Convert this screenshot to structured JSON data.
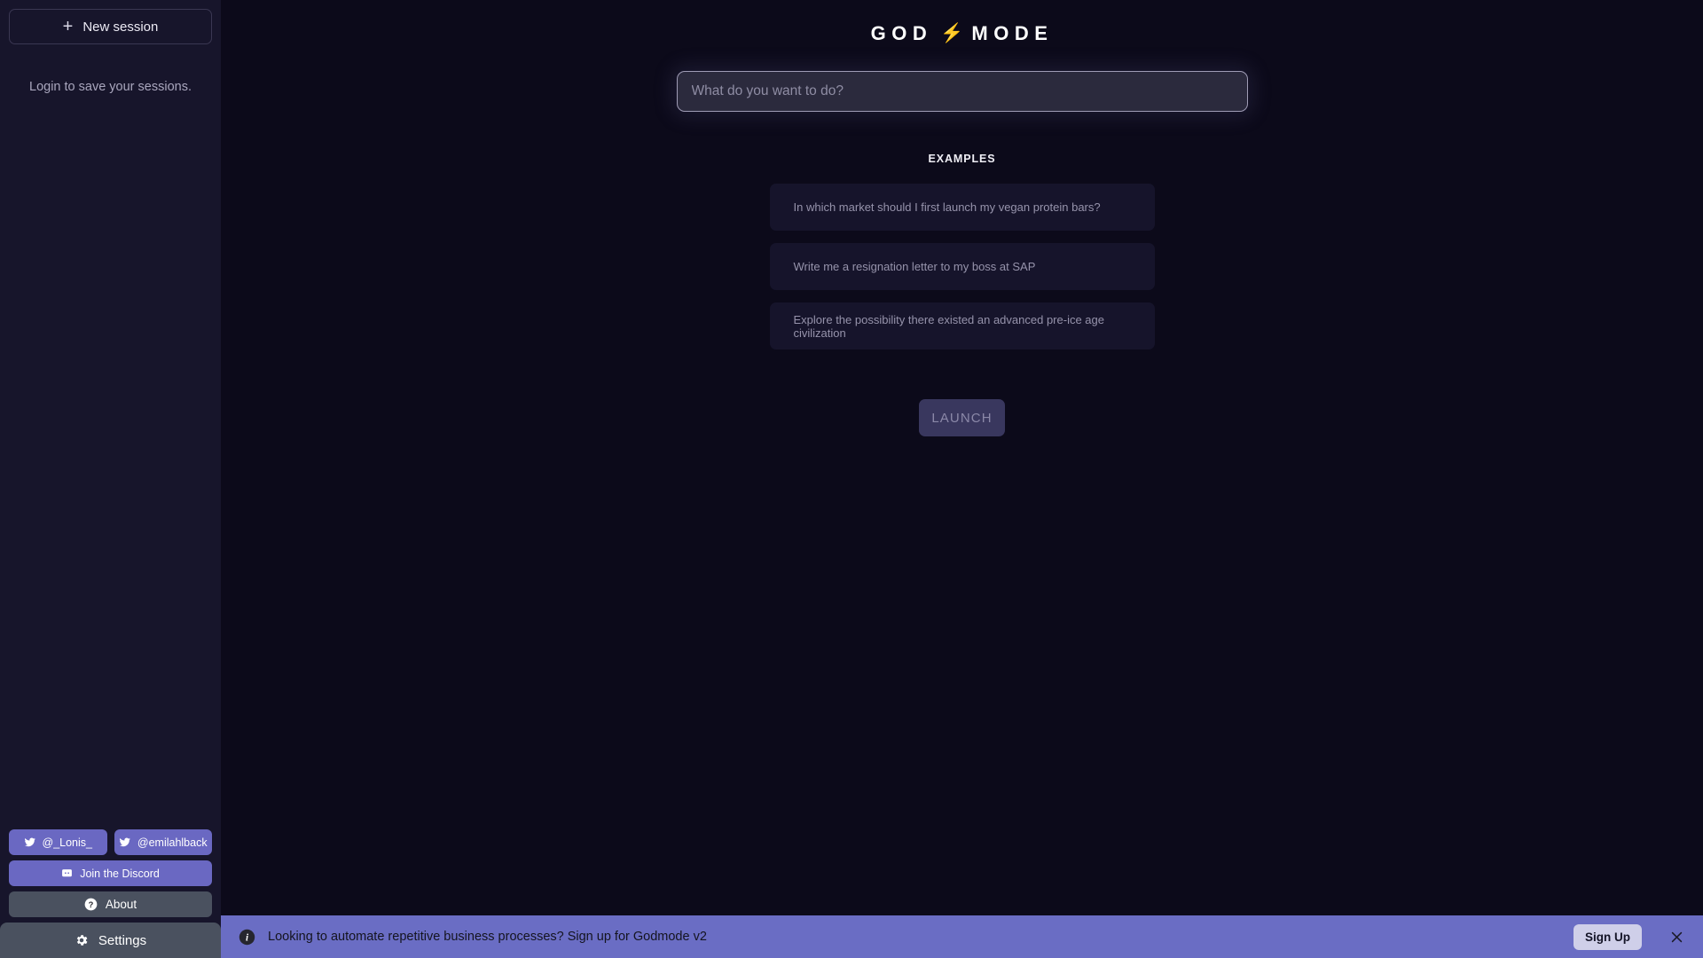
{
  "sidebar": {
    "new_session_label": "New session",
    "new_session_icon": "plus-icon",
    "login_note": "Login to save your sessions.",
    "footer": {
      "twitter_1_label": "@_Lonis_",
      "twitter_2_label": "@emilahlback",
      "twitter_icon": "twitter-bird-icon",
      "discord_label": "Join the Discord",
      "discord_icon": "discord-icon",
      "about_label": "About",
      "about_icon": "help-circle-icon",
      "settings_label": "Settings",
      "settings_icon": "gear-icon"
    }
  },
  "main": {
    "title_left": "GOD",
    "title_bolt": "⚡",
    "title_right": "MODE",
    "prompt_placeholder": "What do you want to do?",
    "prompt_value": "",
    "examples_heading": "EXAMPLES",
    "examples": [
      "In which market should I first launch my vegan protein bars?",
      "Write me a resignation letter to my boss at SAP",
      "Explore the possibility there existed an advanced pre-ice age civilization"
    ],
    "launch_label": "LAUNCH"
  },
  "banner": {
    "info_icon": "info-circle-icon",
    "text": "Looking to automate repetitive business processes? Sign up for Godmode v2",
    "signup_label": "Sign Up",
    "close_icon": "close-icon"
  },
  "colors": {
    "page_bg": "#0c0a1a",
    "sidebar_bg": "#17152b",
    "accent_purple": "#6a68c2",
    "banner_bg": "#6a6dc4",
    "slate_button": "#4a515f",
    "launch_bg": "#39375e",
    "bolt_yellow": "#f7d038"
  }
}
